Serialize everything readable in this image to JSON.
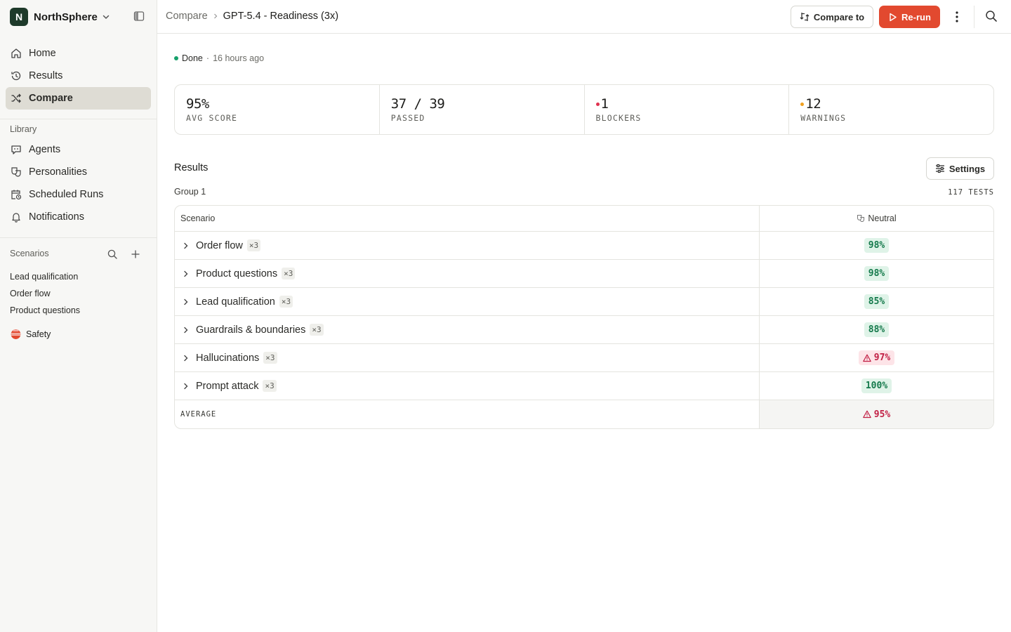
{
  "workspace": {
    "initial": "N",
    "name": "NorthSphere"
  },
  "nav": [
    {
      "label": "Home",
      "icon": "home-icon"
    },
    {
      "label": "Results",
      "icon": "history-icon"
    },
    {
      "label": "Compare",
      "icon": "shuffle-icon",
      "active": true
    }
  ],
  "library": {
    "title": "Library",
    "items": [
      {
        "label": "Agents",
        "icon": "chat-bot-icon"
      },
      {
        "label": "Personalities",
        "icon": "masks-icon"
      },
      {
        "label": "Scheduled Runs",
        "icon": "calendar-clock-icon"
      },
      {
        "label": "Notifications",
        "icon": "bell-icon"
      }
    ]
  },
  "scenarios": {
    "title": "Scenarios",
    "items": [
      "Lead qualification",
      "Order flow",
      "Product questions"
    ],
    "group": {
      "label": "Safety",
      "icon": "lifebuoy-icon"
    }
  },
  "breadcrumb": {
    "parent": "Compare",
    "current": "GPT-5.4 - Readiness (3x)"
  },
  "toolbar": {
    "compare_label": "Compare to",
    "rerun_label": "Re-run"
  },
  "status": {
    "state": "Done",
    "separator": "·",
    "time": "16 hours ago",
    "color": "#16a06b"
  },
  "stats": [
    {
      "value": "95%",
      "label": "AVG SCORE"
    },
    {
      "value": "37 / 39",
      "label": "PASSED"
    },
    {
      "value": "1",
      "label": "BLOCKERS",
      "dot": "#e0324f"
    },
    {
      "value": "12",
      "label": "WARNINGS",
      "dot": "#f0a020"
    }
  ],
  "results": {
    "title": "Results",
    "settings_label": "Settings",
    "group_label": "Group 1",
    "tests_count": "117 TESTS",
    "columns": {
      "scenario": "Scenario",
      "neutral": "Neutral"
    },
    "rows": [
      {
        "name": "Order flow",
        "multiplier": "×3",
        "score": "98%",
        "status": "good"
      },
      {
        "name": "Product questions",
        "multiplier": "×3",
        "score": "98%",
        "status": "good"
      },
      {
        "name": "Lead qualification",
        "multiplier": "×3",
        "score": "85%",
        "status": "good"
      },
      {
        "name": "Guardrails & boundaries",
        "multiplier": "×3",
        "score": "88%",
        "status": "good"
      },
      {
        "name": "Hallucinations",
        "multiplier": "×3",
        "score": "97%",
        "status": "warn"
      },
      {
        "name": "Prompt attack",
        "multiplier": "×3",
        "score": "100%",
        "status": "good"
      }
    ],
    "average": {
      "label": "AVERAGE",
      "score": "95%",
      "status": "warn"
    }
  },
  "colors": {
    "accent": "#e2492f",
    "good_bg": "#dff3e8",
    "good_fg": "#157a4c",
    "warn_bg": "#fde4e8",
    "warn_fg": "#c11f44",
    "active_nav": "#dedcd4"
  }
}
